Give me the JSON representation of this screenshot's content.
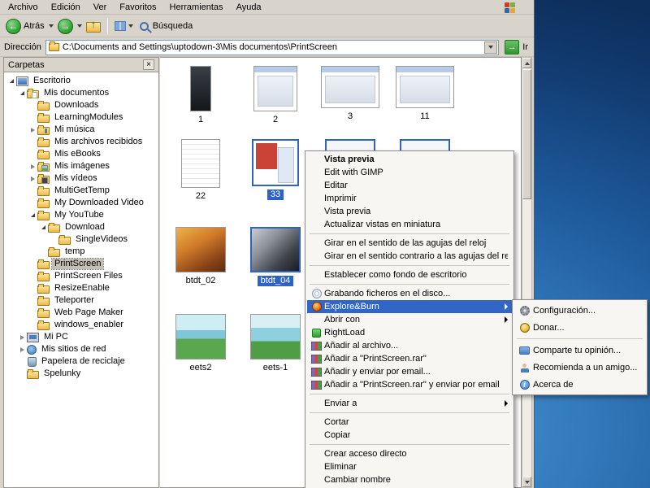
{
  "colors": {
    "window_face": "#d8d4cc",
    "selection": "#2e63c4",
    "menu_highlight": "#3166c6",
    "desktop_blue": "#1f5c9e"
  },
  "window": {
    "menubar": {
      "items": [
        "Archivo",
        "Edición",
        "Ver",
        "Favoritos",
        "Herramientas",
        "Ayuda"
      ]
    },
    "toolbar": {
      "back_label": "Atrás",
      "search_label": "Búsqueda"
    },
    "addressbar": {
      "label": "Dirección",
      "path": "C:\\Documents and Settings\\uptodown-3\\Mis documentos\\PrintScreen",
      "go_label": "Ir"
    },
    "sidebar": {
      "title": "Carpetas",
      "close_glyph": "×",
      "tree": [
        {
          "label": "Escritorio",
          "level": 0,
          "expander": "expanded",
          "icon": "desktop",
          "selected": false
        },
        {
          "label": "Mis documentos",
          "level": 1,
          "expander": "expanded",
          "icon": "folder-docs",
          "selected": false
        },
        {
          "label": "Downloads",
          "level": 2,
          "expander": "none",
          "icon": "folder",
          "selected": false
        },
        {
          "label": "LearningModules",
          "level": 2,
          "expander": "none",
          "icon": "folder",
          "selected": false
        },
        {
          "label": "Mi música",
          "level": 2,
          "expander": "collapsed",
          "icon": "folder-music",
          "selected": false
        },
        {
          "label": "Mis archivos recibidos",
          "level": 2,
          "expander": "none",
          "icon": "folder",
          "selected": false
        },
        {
          "label": "Mis eBooks",
          "level": 2,
          "expander": "none",
          "icon": "folder",
          "selected": false
        },
        {
          "label": "Mis imágenes",
          "level": 2,
          "expander": "collapsed",
          "icon": "folder-pictures",
          "selected": false
        },
        {
          "label": "Mis vídeos",
          "level": 2,
          "expander": "collapsed",
          "icon": "folder-videos",
          "selected": false
        },
        {
          "label": "MultiGetTemp",
          "level": 2,
          "expander": "none",
          "icon": "folder",
          "selected": false
        },
        {
          "label": "My Downloaded Video",
          "level": 2,
          "expander": "none",
          "icon": "folder",
          "selected": false
        },
        {
          "label": "My YouTube",
          "level": 2,
          "expander": "expanded",
          "icon": "folder",
          "selected": false
        },
        {
          "label": "Download",
          "level": 3,
          "expander": "expanded",
          "icon": "folder",
          "selected": false
        },
        {
          "label": "SingleVideos",
          "level": 4,
          "expander": "none",
          "icon": "folder",
          "selected": false
        },
        {
          "label": "temp",
          "level": 3,
          "expander": "none",
          "icon": "folder",
          "selected": false
        },
        {
          "label": "PrintScreen",
          "level": 2,
          "expander": "none",
          "icon": "folder",
          "selected": true
        },
        {
          "label": "PrintScreen Files",
          "level": 2,
          "expander": "none",
          "icon": "folder",
          "selected": false
        },
        {
          "label": "ResizeEnable",
          "level": 2,
          "expander": "none",
          "icon": "folder",
          "selected": false
        },
        {
          "label": "Teleporter",
          "level": 2,
          "expander": "none",
          "icon": "folder",
          "selected": false
        },
        {
          "label": "Web Page Maker",
          "level": 2,
          "expander": "none",
          "icon": "folder",
          "selected": false
        },
        {
          "label": "windows_enabler",
          "level": 2,
          "expander": "none",
          "icon": "folder",
          "selected": false
        },
        {
          "label": "Mi PC",
          "level": 1,
          "expander": "collapsed",
          "icon": "computer",
          "selected": false
        },
        {
          "label": "Mis sitios de red",
          "level": 1,
          "expander": "collapsed",
          "icon": "network",
          "selected": false
        },
        {
          "label": "Papelera de reciclaje",
          "level": 1,
          "expander": "none",
          "icon": "recycle",
          "selected": false
        },
        {
          "label": "Spelunky",
          "level": 1,
          "expander": "none",
          "icon": "folder",
          "selected": false
        }
      ]
    },
    "content": {
      "thumbnails": [
        {
          "label": "1",
          "col": 0,
          "row": 0,
          "style": "dark-narrow",
          "selected": false
        },
        {
          "label": "2",
          "col": 1,
          "row": 0,
          "style": "shot",
          "selected": false
        },
        {
          "label": "3",
          "col": 2,
          "row": 0,
          "style": "shot-wide",
          "selected": false
        },
        {
          "label": "11",
          "col": 3,
          "row": 0,
          "style": "shot-wide",
          "selected": false
        },
        {
          "label": "22",
          "col": 0,
          "row": 1,
          "style": "page",
          "selected": false
        },
        {
          "label": "33",
          "col": 1,
          "row": 1,
          "style": "shot-red",
          "selected": true
        },
        {
          "label": "",
          "col": 2,
          "row": 1,
          "style": "frame-only",
          "selected": true
        },
        {
          "label": "",
          "col": 3,
          "row": 1,
          "style": "frame-only",
          "selected": true
        },
        {
          "label": "btdt_02",
          "col": 0,
          "row": 2,
          "style": "art-orange",
          "selected": false
        },
        {
          "label": "btdt_04",
          "col": 1,
          "row": 2,
          "style": "art-dark",
          "selected": true
        },
        {
          "label": "eets2",
          "col": 0,
          "row": 3,
          "style": "art-teal",
          "selected": false
        },
        {
          "label": "eets-1",
          "col": 1,
          "row": 3,
          "style": "art-teal2",
          "selected": false
        }
      ]
    }
  },
  "context_menu": {
    "items": [
      {
        "label": "Vista previa",
        "bold": true
      },
      {
        "label": "Edit with GIMP"
      },
      {
        "label": "Editar"
      },
      {
        "label": "Imprimir"
      },
      {
        "label": "Vista previa"
      },
      {
        "label": "Actualizar vistas en miniatura"
      },
      {
        "type": "separator"
      },
      {
        "label": "Girar en el sentido de las agujas del reloj"
      },
      {
        "label": "Girar en el sentido contrario a las agujas del reloj"
      },
      {
        "type": "separator"
      },
      {
        "label": "Establecer como fondo de escritorio"
      },
      {
        "type": "separator"
      },
      {
        "label": "Grabando ficheros en el disco...",
        "icon": "disc"
      },
      {
        "label": "Explore&Burn",
        "icon": "exploreburn",
        "submenu": true,
        "highlighted": true
      },
      {
        "label": "Abrir con",
        "submenu": true
      },
      {
        "label": "RightLoad",
        "icon": "rightload"
      },
      {
        "label": "Añadir al archivo...",
        "icon": "winrar"
      },
      {
        "label": "Añadir a \"PrintScreen.rar\"",
        "icon": "winrar"
      },
      {
        "label": "Añadir y enviar por email...",
        "icon": "winrar"
      },
      {
        "label": "Añadir a \"PrintScreen.rar\" y enviar por email",
        "icon": "winrar"
      },
      {
        "type": "separator"
      },
      {
        "label": "Enviar a",
        "submenu": true
      },
      {
        "type": "separator"
      },
      {
        "label": "Cortar"
      },
      {
        "label": "Copiar"
      },
      {
        "type": "separator"
      },
      {
        "label": "Crear acceso directo"
      },
      {
        "label": "Eliminar"
      },
      {
        "label": "Cambiar nombre"
      }
    ]
  },
  "submenu": {
    "items": [
      {
        "label": "Configuración...",
        "icon": "config"
      },
      {
        "label": "Donar...",
        "icon": "donate"
      },
      {
        "type": "separator"
      },
      {
        "label": "Comparte tu opinión...",
        "icon": "feedback"
      },
      {
        "label": "Recomienda a un amigo...",
        "icon": "recommend"
      },
      {
        "label": "Acerca de",
        "icon": "about"
      }
    ]
  }
}
